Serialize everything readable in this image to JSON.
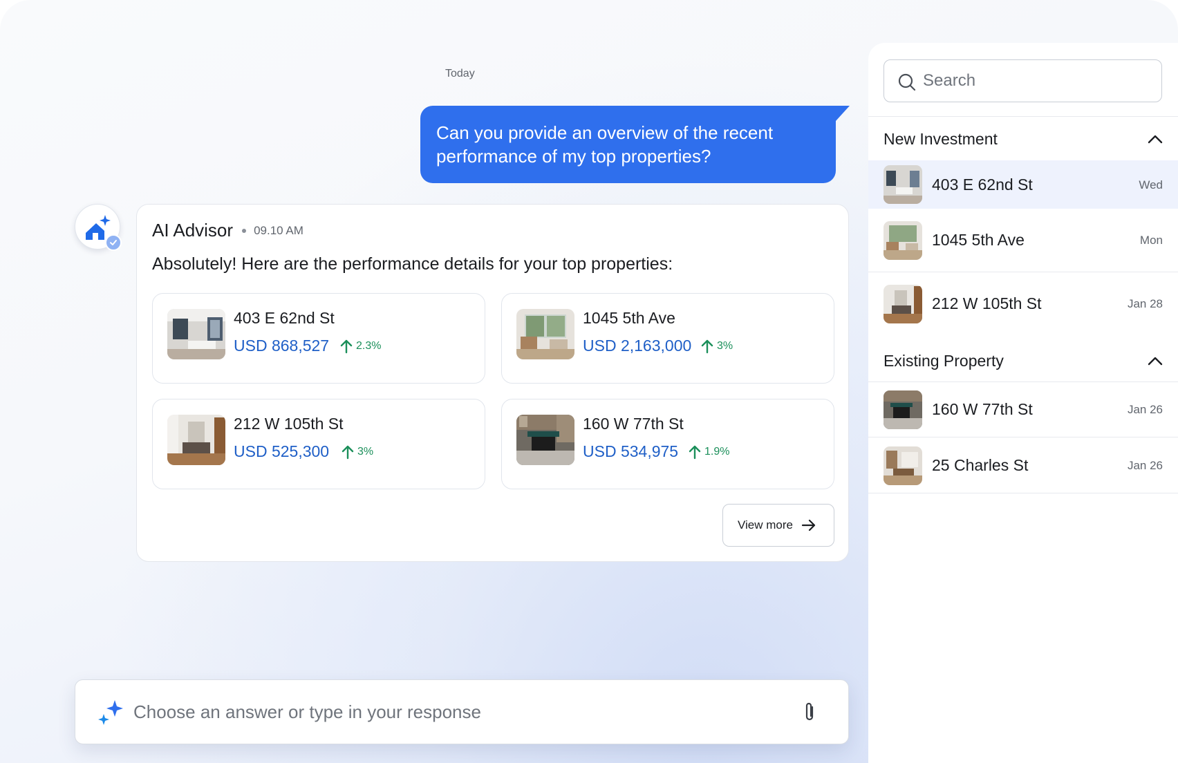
{
  "chat": {
    "date_label": "Today",
    "user_message": "Can you provide an overview of the recent performance of my top properties?",
    "advisor": {
      "name": "AI Advisor",
      "time": "09.10 AM",
      "intro": "Absolutely! Here are the performance details for your top properties:"
    },
    "properties": [
      {
        "name": "403 E 62nd St",
        "price": "USD 868,527",
        "change": "2.3%"
      },
      {
        "name": "1045 5th Ave",
        "price": "USD 2,163,000",
        "change": "3%"
      },
      {
        "name": "212 W 105th St",
        "price": "USD 525,300",
        "change": "3%"
      },
      {
        "name": "160 W 77th St",
        "price": "USD 534,975",
        "change": "1.9%"
      }
    ],
    "view_more_label": "View more"
  },
  "composer": {
    "placeholder": "Choose an answer or type in your response"
  },
  "sidebar": {
    "search_placeholder": "Search",
    "sections": [
      {
        "title": "New Investment",
        "items": [
          {
            "name": "403 E 62nd St",
            "date": "Wed",
            "active": true
          },
          {
            "name": "1045 5th Ave",
            "date": "Mon"
          },
          {
            "name": "212 W 105th St",
            "date": "Jan 28"
          }
        ]
      },
      {
        "title": "Existing Property",
        "items": [
          {
            "name": "160 W 77th St",
            "date": "Jan 26"
          },
          {
            "name": "25 Charles St",
            "date": "Jan 26"
          }
        ]
      }
    ]
  },
  "colors": {
    "accent_blue": "#2f6fed",
    "price_blue": "#1f5fc7",
    "positive_green": "#1b8f5a",
    "active_row": "#eef2fd"
  },
  "icons": {
    "search": "search-icon",
    "chevron": "chevron-up-icon",
    "sparkle": "sparkle-icon",
    "attach": "paperclip-icon",
    "arrow_up": "arrow-up-icon",
    "arrow_right": "arrow-right-icon",
    "advisor": "house-sparkle-icon",
    "verified": "check-badge-icon"
  }
}
